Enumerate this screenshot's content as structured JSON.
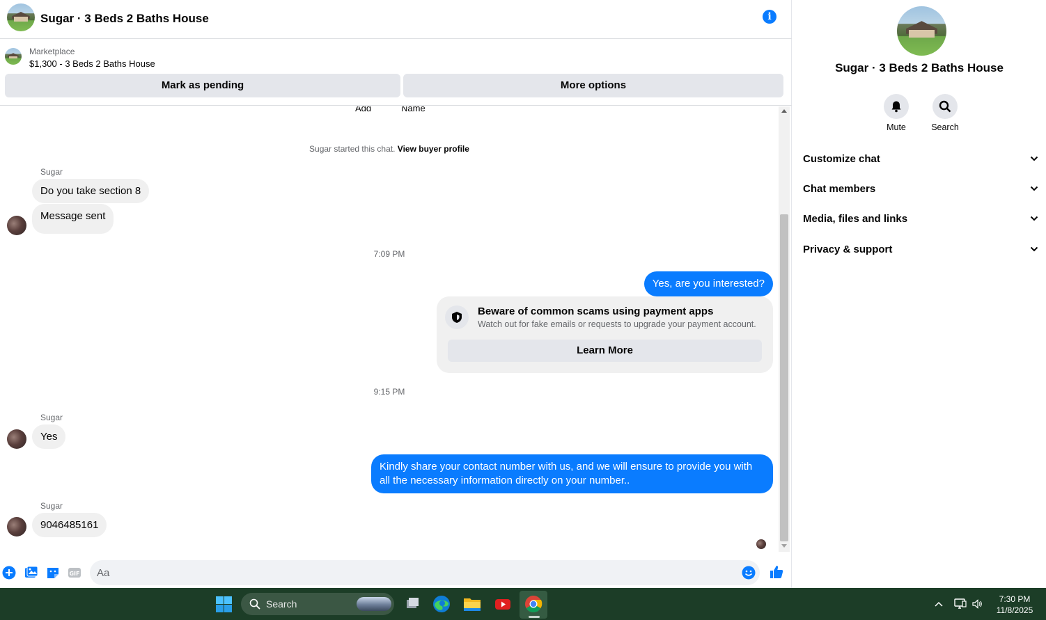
{
  "chat": {
    "title": "Sugar · 3 Beds 2 Baths House",
    "listing": {
      "source": "Marketplace",
      "title": "$1,300 - 3 Beds 2 Baths House"
    },
    "actions": {
      "pending": "Mark as pending",
      "more": "More options"
    },
    "top_partial": {
      "add": "Add",
      "name": "Name"
    },
    "system": {
      "text": "Sugar started this chat.",
      "link": "View buyer profile"
    },
    "messages": {
      "m1_sender": "Sugar",
      "m1": "Do you take section 8",
      "m2": "Message sent",
      "time1": "7:09 PM",
      "m3": "Yes, are you interested?",
      "scam_title": "Beware of common scams using payment apps",
      "scam_sub": "Watch out for fake emails or requests to upgrade your payment account.",
      "scam_button": "Learn More",
      "time2": "9:15 PM",
      "m4_sender": "Sugar",
      "m4": "Yes",
      "m5": "Kindly share your contact number with us, and we will ensure to provide you with all the necessary information directly on your number..",
      "m6_sender": "Sugar",
      "m6": "9046485161"
    },
    "composer": {
      "placeholder": "Aa"
    }
  },
  "details": {
    "title": "Sugar · 3 Beds 2 Baths House",
    "mute_label": "Mute",
    "search_label": "Search",
    "sections": [
      "Customize chat",
      "Chat members",
      "Media, files and links",
      "Privacy & support"
    ]
  },
  "taskbar": {
    "search_label": "Search",
    "time": "7:30 PM",
    "date": "11/8/2025"
  },
  "colors": {
    "accent": "#0a7cff",
    "bubble_in": "#f0f0f0",
    "taskbar": "#1c3d27"
  }
}
